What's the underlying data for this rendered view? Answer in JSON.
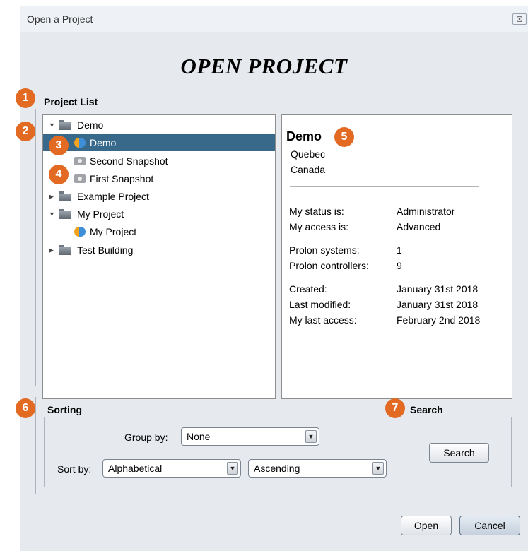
{
  "window": {
    "title": "Open a Project",
    "close_symbol": "☒"
  },
  "dialog_title": "OPEN PROJECT",
  "project_list": {
    "label": "Project List",
    "tree": [
      {
        "label": "Demo",
        "icon": "folder-icon",
        "expanded": true
      },
      {
        "label": "Demo",
        "icon": "project-logo-icon",
        "selected": true
      },
      {
        "label": "Second Snapshot",
        "icon": "camera-icon"
      },
      {
        "label": "First Snapshot",
        "icon": "camera-icon"
      },
      {
        "label": "Example Project",
        "icon": "folder-icon",
        "expanded": false
      },
      {
        "label": "My Project",
        "icon": "folder-icon",
        "expanded": true
      },
      {
        "label": "My Project",
        "icon": "project-logo-icon"
      },
      {
        "label": "Test Building",
        "icon": "folder-icon",
        "expanded": false
      }
    ]
  },
  "details": {
    "name": "Demo",
    "region": "Quebec",
    "country": "Canada",
    "rows": [
      {
        "label": "My status is:",
        "value": "Administrator"
      },
      {
        "label": "My access is:",
        "value": "Advanced"
      },
      {
        "label": "Prolon systems:",
        "value": "1"
      },
      {
        "label": "Prolon controllers:",
        "value": "9"
      },
      {
        "label": "Created:",
        "value": "January 31st 2018"
      },
      {
        "label": "Last modified:",
        "value": "January 31st 2018"
      },
      {
        "label": "My last access:",
        "value": "February 2nd 2018"
      }
    ]
  },
  "sorting": {
    "label": "Sorting",
    "group_by_label": "Group by:",
    "group_by_value": "None",
    "sort_by_label": "Sort by:",
    "sort_by_value": "Alphabetical",
    "order_value": "Ascending"
  },
  "search": {
    "label": "Search",
    "button": "Search"
  },
  "footer": {
    "open": "Open",
    "cancel": "Cancel"
  },
  "callouts": [
    "1",
    "2",
    "3",
    "4",
    "5",
    "6",
    "7"
  ],
  "colors": {
    "callout": "#e26a22",
    "selection": "#39698a"
  }
}
